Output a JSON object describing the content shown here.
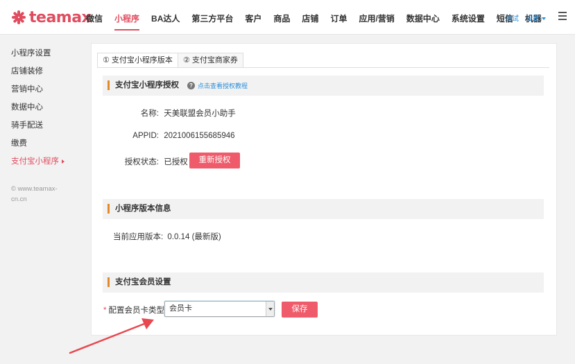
{
  "brand": {
    "logo_text": "teamax",
    "accent_color": "#e04d5f"
  },
  "nav": {
    "items": [
      {
        "label": "微信",
        "active": false
      },
      {
        "label": "小程序",
        "active": true
      },
      {
        "label": "BA达人",
        "active": false
      },
      {
        "label": "第三方平台",
        "active": false
      },
      {
        "label": "客户",
        "active": false
      },
      {
        "label": "商品",
        "active": false
      },
      {
        "label": "店铺",
        "active": false
      },
      {
        "label": "订单",
        "active": false
      },
      {
        "label": "应用/营销",
        "active": false
      },
      {
        "label": "数据中心",
        "active": false
      },
      {
        "label": "系统设置",
        "active": false
      },
      {
        "label": "短信",
        "active": false
      },
      {
        "label": "机器",
        "active": false
      }
    ],
    "user_link": "测试",
    "settings_label": "设置",
    "menu_icon": "hamburger-icon"
  },
  "sidebar": {
    "items": [
      {
        "label": "小程序设置",
        "active": false
      },
      {
        "label": "店铺装修",
        "active": false
      },
      {
        "label": "营销中心",
        "active": false
      },
      {
        "label": "数据中心",
        "active": false
      },
      {
        "label": "骑手配送",
        "active": false
      },
      {
        "label": "缴费",
        "active": false
      },
      {
        "label": "支付宝小程序",
        "active": true
      }
    ],
    "copyright": "© www.teamax-cn.cn"
  },
  "tabs": [
    {
      "label": "① 支付宝小程序版本",
      "active": true
    },
    {
      "label": "② 支付宝商家券",
      "active": false
    }
  ],
  "auth_section": {
    "title": "支付宝小程序授权",
    "help_icon": "question-circle-icon",
    "help_link": "点击查看授权教程",
    "name_label": "名称:",
    "name_value": "天美联盟会员小助手",
    "appid_label": "APPID:",
    "appid_value": "2021006155685946",
    "status_label": "授权状态:",
    "status_value": "已授权",
    "reauth_button": "重新授权"
  },
  "version_section": {
    "title": "小程序版本信息",
    "current_label": "当前应用版本:",
    "current_value": "0.0.14 (最新版)"
  },
  "member_section": {
    "title": "支付宝会员设置",
    "required_mark": "*",
    "card_type_label": "配置会员卡类型:",
    "card_type_value": "会员卡",
    "save_button": "保存"
  },
  "annotation_color": "#e8474f"
}
